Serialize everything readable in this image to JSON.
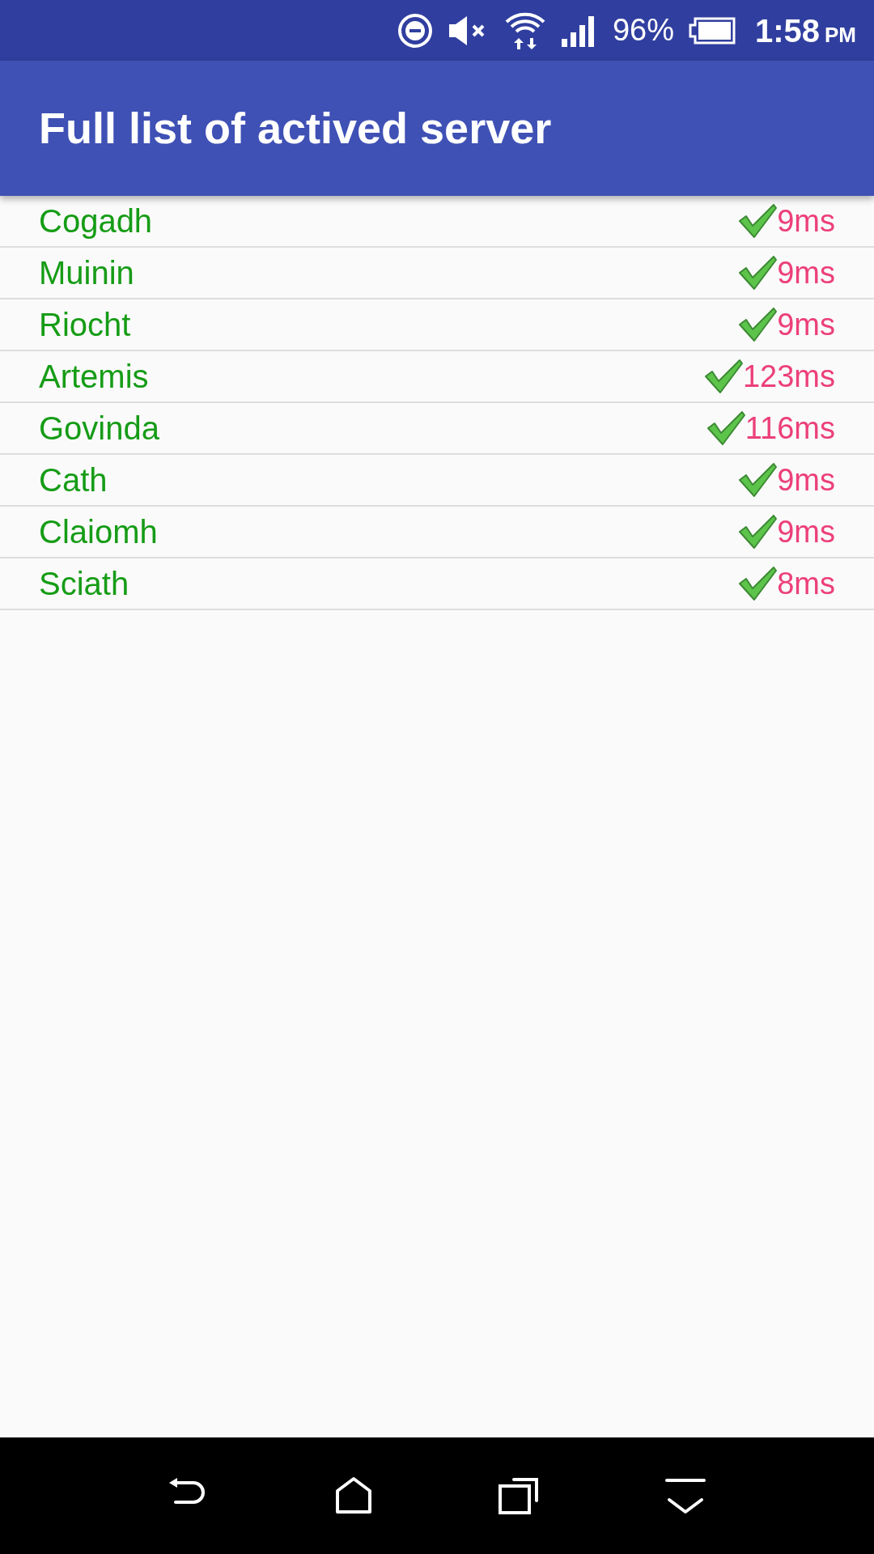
{
  "status_bar": {
    "battery": "96%",
    "time": "1:58",
    "time_suffix": "PM"
  },
  "app_bar": {
    "title": "Full list of actived server"
  },
  "servers": [
    {
      "name": "Cogadh",
      "active": true,
      "latency": "9ms"
    },
    {
      "name": "Muinin",
      "active": true,
      "latency": "9ms"
    },
    {
      "name": "Riocht",
      "active": true,
      "latency": "9ms"
    },
    {
      "name": "Artemis",
      "active": true,
      "latency": "123ms"
    },
    {
      "name": "Govinda",
      "active": true,
      "latency": "116ms"
    },
    {
      "name": "Cath",
      "active": true,
      "latency": "9ms"
    },
    {
      "name": "Claiomh",
      "active": true,
      "latency": "9ms"
    },
    {
      "name": "Sciath",
      "active": true,
      "latency": "8ms"
    }
  ]
}
